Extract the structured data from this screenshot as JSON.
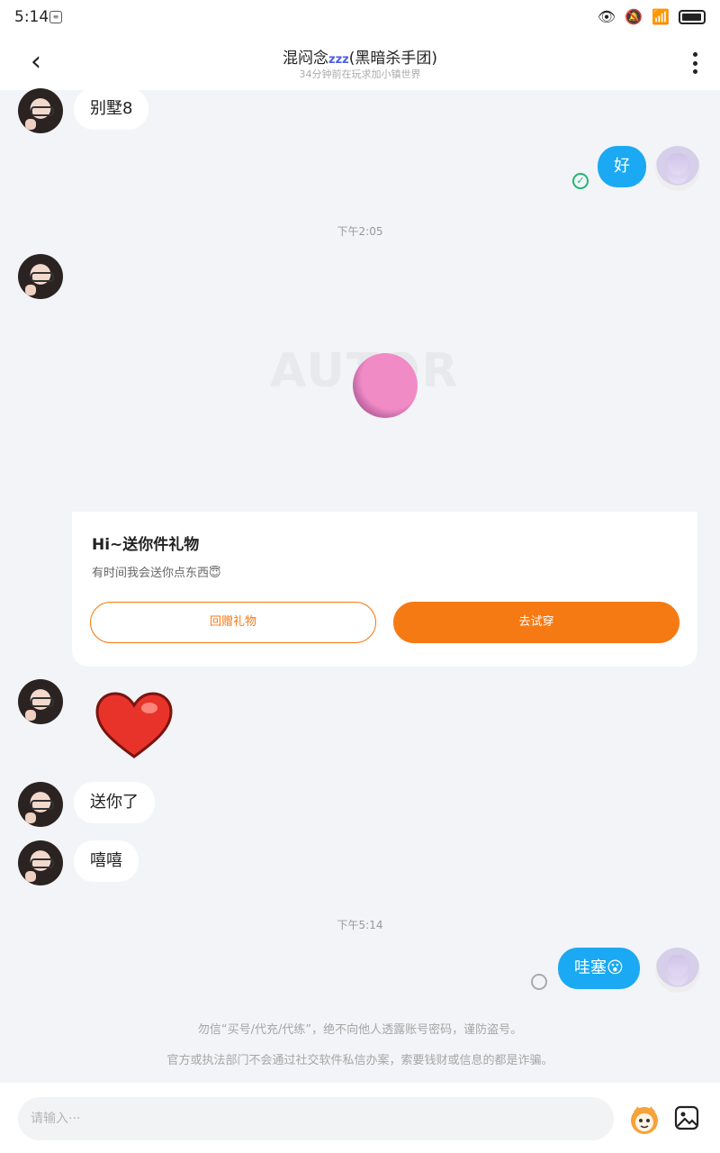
{
  "status_bar": {
    "time": "5:14"
  },
  "header": {
    "title": "混闷念",
    "title_zzz": "zzz",
    "title_suffix": "(黑暗杀手团)",
    "subtitle": "34分钟前在玩求加小镇世界"
  },
  "messages": {
    "m1": "别墅8",
    "m2": "好",
    "time1": "下午2:05",
    "gift_card": {
      "title": "Hi~送你件礼物",
      "desc": "有时间我会送你点东西😇",
      "watermark": "AUTOR",
      "btn_return": "回赠礼物",
      "btn_try": "去试穿"
    },
    "m3": "送你了",
    "m4": "嘻嘻",
    "time2": "下午5:14",
    "m5": "哇塞😮"
  },
  "notices": {
    "line1": "勿信“买号/代充/代练”，绝不向他人透露账号密码，谨防盗号。",
    "line2": "官方或执法部门不会通过社交软件私信办案，索要钱财或信息的都是诈骗。"
  },
  "input": {
    "placeholder": "请输入···"
  },
  "colors": {
    "accent": "#f57a14",
    "my_bubble": "#1aa9f2",
    "read_check": "#22b573"
  }
}
